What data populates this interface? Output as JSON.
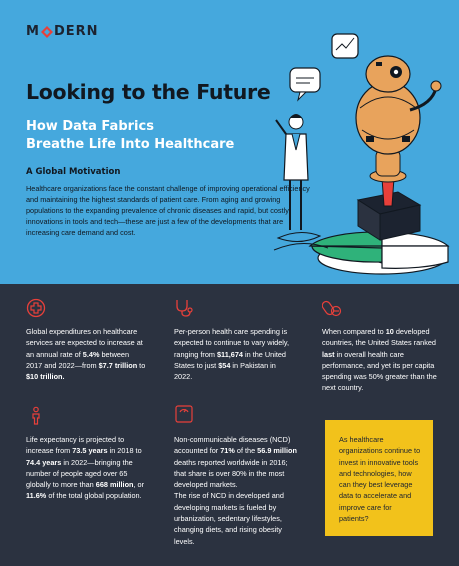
{
  "header": {
    "logo_text_1": "M",
    "logo_text_2": "DERN",
    "title": "Looking to the Future",
    "subtitle_line1": "How Data Fabrics",
    "subtitle_line2": "Breathe Life Into Healthcare"
  },
  "intro": {
    "heading": "A Global Motivation",
    "body": "Healthcare organizations face the constant challenge of improving operational efficiency and maintaining the highest standards of patient care. From aging and growing populations to the expanding prevalence of chronic diseases and rapid, but costly, innovations in tools and tech—these are just a few of the developments that are increasing care demand and cost."
  },
  "stats": {
    "expenditures": {
      "p1": "Global expenditures on healthcare services are expected to increase at an annual rate of ",
      "b1": "5.4%",
      "p2": " between 2017 and 2022—from ",
      "b2": "$7.7 trillion",
      "p3": " to ",
      "b3": "$10 trillion."
    },
    "spending": {
      "p1": "Per-person health care spending is expected to continue to vary widely, ranging from ",
      "b1": "$11,674",
      "p2": " in the United States to just ",
      "b2": "$54",
      "p3": " in Pakistan in 2022."
    },
    "ranking": {
      "p1": "When compared to ",
      "b1": "10",
      "p2": " developed countries, the United States ranked ",
      "b2": "last",
      "p3": " in overall health care performance, and yet its per capita spending was 50% greater than the next country."
    },
    "life": {
      "p1": "Life expectancy is projected to increase from ",
      "b1": "73.5 years",
      "p2": " in 2018 to ",
      "b2": "74.4 years",
      "p3": " in 2022—bringing the number of people aged over 65 globally to more than ",
      "b3": "668 million",
      "p4": ", or ",
      "b4": "11.6%",
      "p5": " of the total global population."
    },
    "ncd": {
      "p1": "Non-communicable diseases (NCD) accounted for ",
      "b1": "71%",
      "p2": " of the ",
      "b2": "56.9 million",
      "p3": " deaths reported worldwide in 2016; that share is over 80% in the most developed markets.",
      "p4": "The rise of NCD in developed and developing markets is fueled by urbanization, sedentary lifestyles, changing diets, and rising obesity levels."
    }
  },
  "callout": {
    "text": "As healthcare organizations continue to invest in innovative tools and technologies, how can they best leverage data to accelerate and improve care for patients?"
  },
  "colors": {
    "top_bg": "#45a8dd",
    "bottom_bg": "#2b3240",
    "accent_red": "#e8403a",
    "callout_bg": "#f2c21b"
  },
  "icons": [
    "medical-cross-icon",
    "stethoscope-icon",
    "pills-icon",
    "person-icon",
    "scale-icon"
  ]
}
